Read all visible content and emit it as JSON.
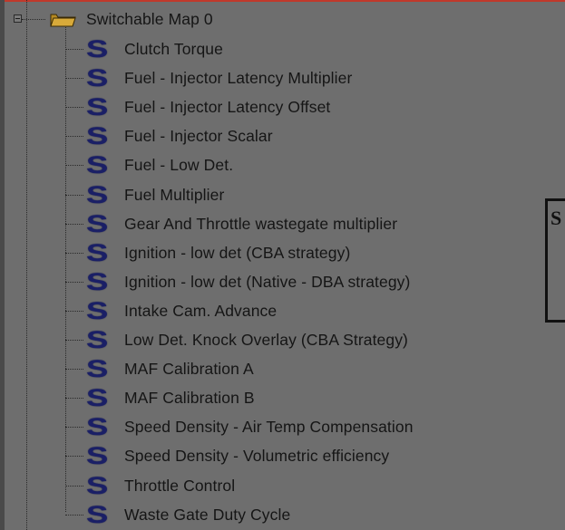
{
  "tree": {
    "root": {
      "label": "Switchable Map 0"
    },
    "items": [
      {
        "label": "Clutch Torque"
      },
      {
        "label": "Fuel - Injector Latency Multiplier"
      },
      {
        "label": "Fuel - Injector Latency Offset"
      },
      {
        "label": "Fuel - Injector Scalar"
      },
      {
        "label": "Fuel - Low Det."
      },
      {
        "label": "Fuel Multiplier"
      },
      {
        "label": "Gear And Throttle wastegate multiplier"
      },
      {
        "label": "Ignition - low det (CBA strategy)"
      },
      {
        "label": "Ignition - low det (Native - DBA strategy)"
      },
      {
        "label": "Intake Cam. Advance"
      },
      {
        "label": "Low Det. Knock Overlay (CBA Strategy)"
      },
      {
        "label": "MAF Calibration A"
      },
      {
        "label": "MAF Calibration B"
      },
      {
        "label": "Speed Density - Air Temp Compensation"
      },
      {
        "label": "Speed Density - Volumetric efficiency"
      },
      {
        "label": "Throttle Control"
      },
      {
        "label": "Waste Gate Duty Cycle"
      }
    ]
  },
  "side_panel": {
    "text": "S"
  },
  "icons": {
    "folder": "folder-open-icon",
    "map": "map-s-icon",
    "expander": "collapse-icon"
  },
  "colors": {
    "background": "#6e6e6e",
    "map_icon": "#1a1f66",
    "folder": "#c8a030"
  }
}
